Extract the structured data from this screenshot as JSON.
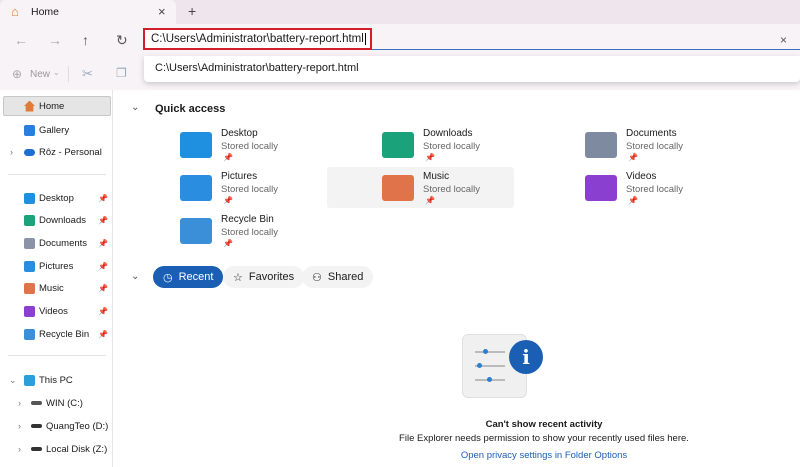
{
  "tab": {
    "title": "Home",
    "close": "×",
    "new_tab": "+"
  },
  "nav": {
    "back": "←",
    "forward": "→",
    "up": "↑",
    "refresh": "↻"
  },
  "address": {
    "value": "C:\\Users\\Administrator\\battery-report.html",
    "clear": "×",
    "suggestion": "C:\\Users\\Administrator\\battery-report.html"
  },
  "toolbar": {
    "new_label": "New"
  },
  "sidebar": {
    "top": [
      {
        "label": "Home"
      },
      {
        "label": "Gallery"
      },
      {
        "label": "Rôz - Personal"
      }
    ],
    "pinned": [
      {
        "label": "Desktop"
      },
      {
        "label": "Downloads"
      },
      {
        "label": "Documents"
      },
      {
        "label": "Pictures"
      },
      {
        "label": "Music"
      },
      {
        "label": "Videos"
      },
      {
        "label": "Recycle Bin"
      }
    ],
    "pc": [
      {
        "label": "This PC"
      },
      {
        "label": "WIN (C:)"
      },
      {
        "label": "QuangTeo (D:)"
      },
      {
        "label": "Local Disk (Z:)"
      }
    ]
  },
  "quick_access": {
    "title": "Quick access",
    "items": [
      {
        "name": "Desktop",
        "status": "Stored locally",
        "color": "#1f8fe0"
      },
      {
        "name": "Downloads",
        "status": "Stored locally",
        "color": "#1aa37a"
      },
      {
        "name": "Documents",
        "status": "Stored locally",
        "color": "#7d8aa0"
      },
      {
        "name": "Pictures",
        "status": "Stored locally",
        "color": "#2a8de0"
      },
      {
        "name": "Music",
        "status": "Stored locally",
        "color": "#e0734a"
      },
      {
        "name": "Videos",
        "status": "Stored locally",
        "color": "#8a3fd0"
      },
      {
        "name": "Recycle Bin",
        "status": "Stored locally",
        "color": "#3b8ed8"
      }
    ]
  },
  "filters": {
    "recent": "Recent",
    "favorites": "Favorites",
    "shared": "Shared"
  },
  "empty": {
    "title": "Can't show recent activity",
    "message": "File Explorer needs permission to show your recently used files here.",
    "link": "Open privacy settings in Folder Options"
  },
  "colors": {
    "accent": "#1a5fb4",
    "address_border": "#d21e2b"
  }
}
